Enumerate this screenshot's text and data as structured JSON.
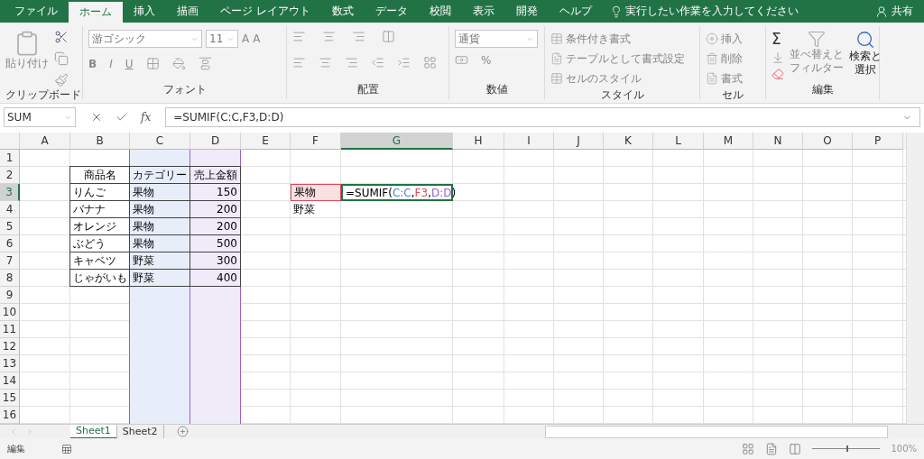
{
  "menu_tabs": [
    {
      "label": "ファイル",
      "selected": false
    },
    {
      "label": "ホーム",
      "selected": true
    },
    {
      "label": "挿入",
      "selected": false
    },
    {
      "label": "描画",
      "selected": false
    },
    {
      "label": "ページ レイアウト",
      "selected": false
    },
    {
      "label": "数式",
      "selected": false
    },
    {
      "label": "データ",
      "selected": false
    },
    {
      "label": "校閲",
      "selected": false
    },
    {
      "label": "表示",
      "selected": false
    },
    {
      "label": "開発",
      "selected": false
    },
    {
      "label": "ヘルプ",
      "selected": false
    }
  ],
  "tell_me": "実行したい作業を入力してください",
  "share": "共有",
  "ribbon": {
    "clipboard": {
      "label": "クリップボード",
      "paste": {
        "label": "貼り付け",
        "disabled": true
      }
    },
    "font": {
      "label": "フォント",
      "font_name": "游ゴシック",
      "font_size": "11",
      "grow_font": "A",
      "shrink_font": "A",
      "bold": "B",
      "italic": "I",
      "underline": "U"
    },
    "alignment": {
      "label": "配置"
    },
    "number": {
      "label": "数値",
      "format": "通貨",
      "percent": "%"
    },
    "styles": {
      "label": "スタイル",
      "items": [
        {
          "label": "条件付き書式",
          "disabled": true
        },
        {
          "label": "テーブルとして書式設定",
          "disabled": true
        },
        {
          "label": "セルのスタイル",
          "disabled": true
        }
      ]
    },
    "cells": {
      "label": "セル",
      "items": [
        {
          "label": "挿入",
          "disabled": true
        },
        {
          "label": "削除",
          "disabled": true
        },
        {
          "label": "書式",
          "disabled": true
        }
      ]
    },
    "editing": {
      "label": "編集",
      "autosum": "Σ",
      "sort": {
        "lines": [
          "並べ替えと",
          "フィルター"
        ],
        "disabled": true
      },
      "find": {
        "lines": [
          "検索と",
          "選択"
        ],
        "disabled": false
      }
    }
  },
  "formula_bar": {
    "name_box": "SUM",
    "fx": "fx",
    "formula": "=SUMIF(C:C,F3,D:D)"
  },
  "sheet": {
    "columns": [
      {
        "label": "A",
        "selected": false
      },
      {
        "label": "B",
        "selected": false
      },
      {
        "label": "C",
        "selected": false
      },
      {
        "label": "D",
        "selected": false
      },
      {
        "label": "E",
        "selected": false
      },
      {
        "label": "F",
        "selected": false
      },
      {
        "label": "G",
        "selected": true
      },
      {
        "label": "H",
        "selected": false
      },
      {
        "label": "I",
        "selected": false
      },
      {
        "label": "J",
        "selected": false
      },
      {
        "label": "K",
        "selected": false
      },
      {
        "label": "L",
        "selected": false
      },
      {
        "label": "M",
        "selected": false
      },
      {
        "label": "N",
        "selected": false
      },
      {
        "label": "O",
        "selected": false
      },
      {
        "label": "P",
        "selected": false
      }
    ],
    "rows": [
      {
        "label": "1",
        "selected": false
      },
      {
        "label": "2",
        "selected": false
      },
      {
        "label": "3",
        "selected": true
      },
      {
        "label": "4",
        "selected": false
      },
      {
        "label": "5",
        "selected": false
      },
      {
        "label": "6",
        "selected": false
      },
      {
        "label": "7",
        "selected": false
      },
      {
        "label": "8",
        "selected": false
      },
      {
        "label": "9",
        "selected": false
      },
      {
        "label": "10",
        "selected": false
      },
      {
        "label": "11",
        "selected": false
      },
      {
        "label": "12",
        "selected": false
      },
      {
        "label": "13",
        "selected": false
      },
      {
        "label": "14",
        "selected": false
      },
      {
        "label": "15",
        "selected": false
      },
      {
        "label": "16",
        "selected": false
      }
    ],
    "table": {
      "columns": [
        "商品名",
        "カテゴリー",
        "売上金額"
      ],
      "rows": [
        [
          "りんご",
          "果物",
          "150"
        ],
        [
          "バナナ",
          "果物",
          "200"
        ],
        [
          "オレンジ",
          "果物",
          "200"
        ],
        [
          "ぶどう",
          "果物",
          "500"
        ],
        [
          "キャベツ",
          "野菜",
          "300"
        ],
        [
          "じゃがいも",
          "野菜",
          "400"
        ]
      ]
    },
    "criteria": [
      "果物",
      "野菜"
    ],
    "formula_cell": [
      {
        "text": "=SUMIF("
      },
      {
        "text": "C:C",
        "color": "#4a7fd4"
      },
      {
        "text": ","
      },
      {
        "text": "F3",
        "color": "#e0475b"
      },
      {
        "text": ","
      },
      {
        "text": "D:D",
        "color": "#9a63c9"
      },
      {
        "text": ")"
      }
    ]
  },
  "sheet_tabs": [
    {
      "label": "Sheet1",
      "selected": true
    },
    {
      "label": "Sheet2",
      "selected": false
    }
  ],
  "status": {
    "mode": "編集",
    "zoom": "100%",
    "zoom_slider": {
      "level": 0.5
    }
  }
}
